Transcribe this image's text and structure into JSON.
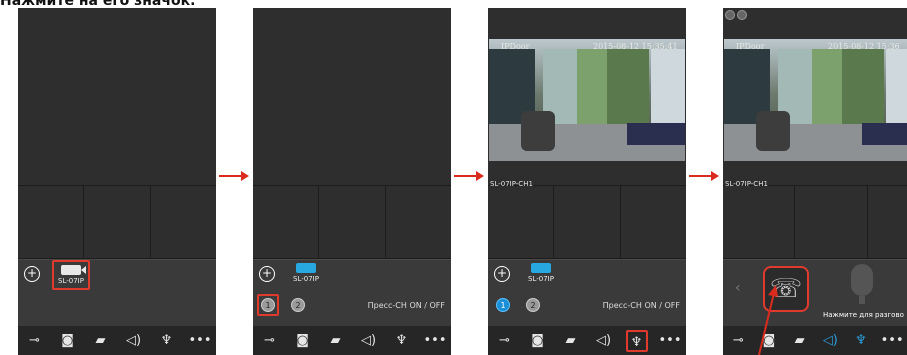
{
  "caption": "Нажмите на его значок.",
  "screens": [
    {
      "device_label": "SL-07IP",
      "toolbar": [
        "key-icon",
        "camera-icon",
        "record-icon",
        "speaker-icon",
        "mic-icon",
        "more-icon"
      ]
    },
    {
      "device_label": "SL-07IP",
      "channel_buttons": [
        "1",
        "2"
      ],
      "press_text": "Пресс-CH ON / OFF"
    },
    {
      "device_label": "SL-07IP",
      "channel_buttons": [
        "1",
        "2"
      ],
      "press_text": "Пресс-CH ON / OFF",
      "video": {
        "osd_name": "IPDoor",
        "osd_time": "2015-08-12 15:35:41"
      },
      "channel_label": "SL-07IP-CH1"
    },
    {
      "video": {
        "osd_name": "IPDoor",
        "osd_time": "2015-08-12 15:36"
      },
      "channel_label": "SL-07IP-CH1",
      "talk_hint": "Нажмите для разгово"
    }
  ],
  "colors": {
    "highlight": "#e03a2f",
    "arrow": "#d92b1e",
    "active_blue": "#1a8fd6"
  }
}
